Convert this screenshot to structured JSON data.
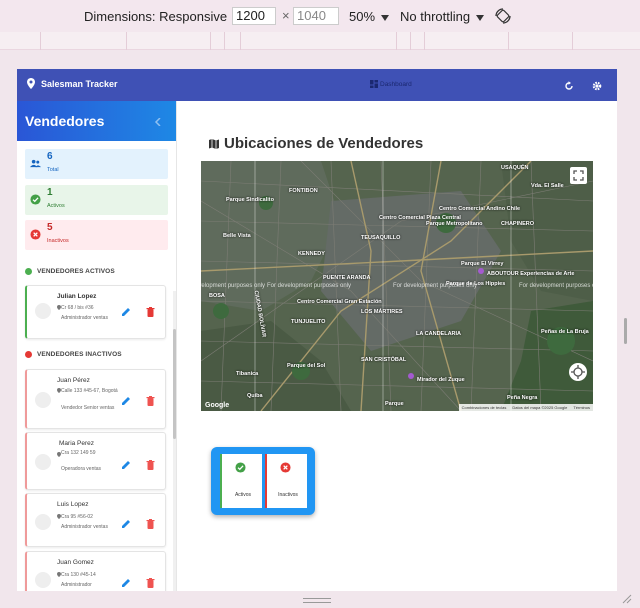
{
  "devtools": {
    "dimensions_label": "Dimensions: Responsive",
    "width": "1200",
    "times": "×",
    "height": "1040",
    "zoom": "50%",
    "throttling": "No throttling"
  },
  "app": {
    "brand": "Salesman Tracker",
    "nav_label": "Dashboard",
    "accent": "#3f51b5"
  },
  "sidebar": {
    "title": "Vendedores",
    "stats": [
      {
        "value": "6",
        "label": "Total",
        "bg": "#e3f2fd",
        "color": "#1565c0"
      },
      {
        "value": "1",
        "label": "Activos",
        "bg": "#e8f5e9",
        "color": "#2e7d32"
      },
      {
        "value": "5",
        "label": "Inactivos",
        "bg": "#ffebee",
        "color": "#c62828"
      }
    ],
    "active_title": "VENDEDORES ACTIVOS",
    "inactive_title": "VENDEDORES INACTIVOS",
    "active": [
      {
        "name": "Julian Lopez",
        "address": "Cr 68 / bis #36",
        "role": "Administrador ventas"
      }
    ],
    "inactive": [
      {
        "name": "Juan Pérez",
        "address": "Calle 133 #45-67, Bogotá",
        "role": "Vendedor Senior ventas"
      },
      {
        "name": "Maria Perez",
        "address": "Cra 132 149 59",
        "role": "Operadora ventas"
      },
      {
        "name": "Luis Lopez",
        "address": "Cra 95 #56-02",
        "role": "Administrador ventas"
      },
      {
        "name": "Juan Gomez",
        "address": "Cra 130 #45-14",
        "role": "Administrador"
      }
    ]
  },
  "main": {
    "title": "Ubicaciones de Vendedores",
    "map": {
      "labels": [
        "FONTIBON",
        "Parque Sindicalito",
        "Belle Vista",
        "BOSA",
        "KENNEDY",
        "TEUSAQUILLO",
        "Parque Metropolitano",
        "PUENTE ARANDA",
        "Centro Comercial Plaza Central",
        "Centro Comercial Gran Estación",
        "Parque El Virrey",
        "Parque de Los Hippies",
        "LOS MÁRTIRES",
        "LA CANDELARIA",
        "TUNJUELITO",
        "CIUDAD BOLÍVAR",
        "SAN CRISTÓBAL",
        "Tibanica",
        "Parque del Sol",
        "Mirador del Zuque",
        "Peña Negra",
        "Peñas de La Bruja",
        "Vda. El Salle",
        "USAQUÉN",
        "CHAPINERO",
        "ABOUTOUR Experiencias de Arte",
        "Centro Comercial Andino Chile",
        "Quiba",
        "Parque"
      ],
      "watermark": "For development purposes only",
      "google": "Google",
      "attribution": [
        "Combinaciones de teclas",
        "Datos del mapa ©2025 Google",
        "Términos"
      ]
    },
    "legend": [
      {
        "label": "Activos",
        "color": "#4caf50"
      },
      {
        "label": "Inactivos",
        "color": "#e53935"
      }
    ]
  }
}
